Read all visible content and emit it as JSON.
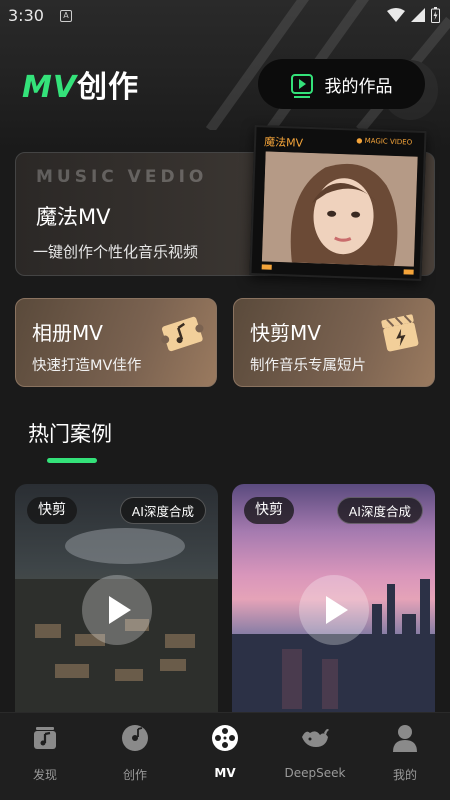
{
  "status_bar": {
    "time": "3:30",
    "notification_glyph": "A"
  },
  "header": {
    "logo_mv": "MV",
    "logo_cz": "创作",
    "my_works_label": "我的作品"
  },
  "magic_card": {
    "bg_text": "MUSIC VEDIO",
    "title": "魔法MV",
    "subtitle": "一键创作个性化音乐视频",
    "frame_title": "魔法MV",
    "frame_tag": "● MAGIC VIDEO"
  },
  "cards": [
    {
      "title": "相册MV",
      "subtitle": "快速打造MV佳作",
      "icon": "music-ticket-icon"
    },
    {
      "title": "快剪MV",
      "subtitle": "制作音乐专属短片",
      "icon": "clapperboard-bolt-icon"
    }
  ],
  "section": {
    "title": "热门案例"
  },
  "cases": [
    {
      "tag": "快剪",
      "badge": "AI深度合成"
    },
    {
      "tag": "快剪",
      "badge": "AI深度合成"
    }
  ],
  "tabs": [
    {
      "label": "发现",
      "icon": "discover-icon"
    },
    {
      "label": "创作",
      "icon": "disc-icon"
    },
    {
      "label": "MV",
      "icon": "film-reel-icon",
      "active": true
    },
    {
      "label": "DeepSeek",
      "icon": "whale-icon"
    },
    {
      "label": "我的",
      "icon": "person-icon"
    }
  ],
  "colors": {
    "accent": "#34e27a",
    "background": "#1a1a1a",
    "card_brown": "#7a6250",
    "frame_orange": "#f4a43a"
  }
}
